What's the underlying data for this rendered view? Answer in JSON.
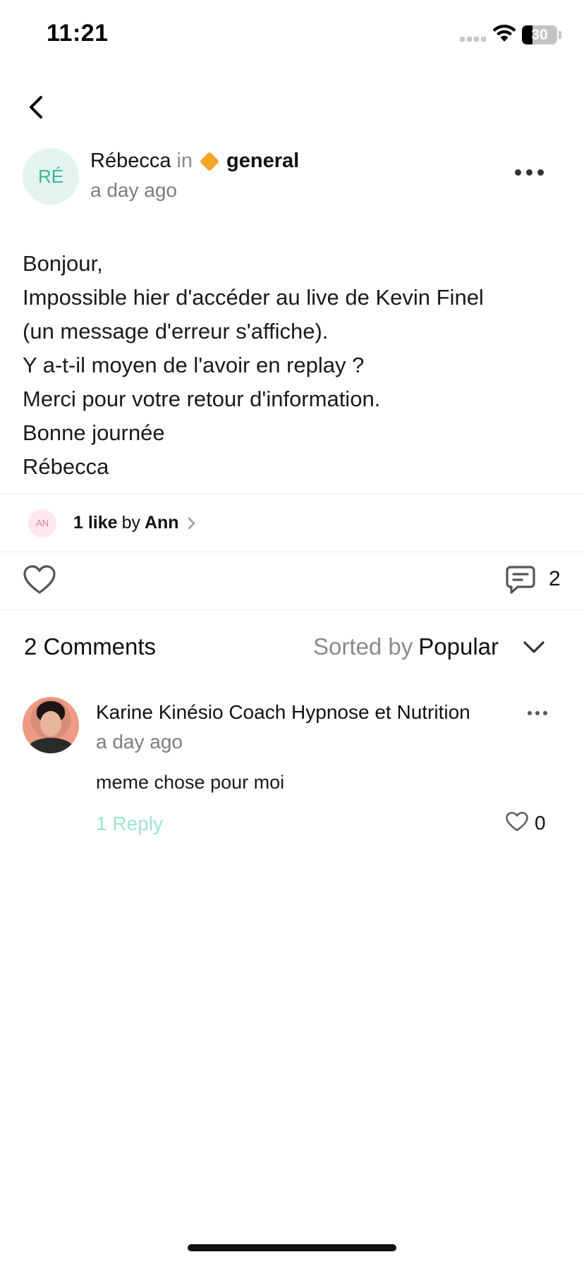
{
  "status_bar": {
    "time": "11:21",
    "battery": "30",
    "battery_level": 0.3
  },
  "post": {
    "author_initials": "RÉ",
    "author": "Rébecca",
    "in_label": "in",
    "space_icon": "orange-diamond",
    "space": "general",
    "time": "a day ago",
    "body_lines": [
      "Bonjour,",
      "Impossible hier d'accéder au live de Kevin Finel",
      "(un message d'erreur s'affiche).",
      "Y a-t-il moyen de l'avoir en replay ?",
      "Merci pour votre retour d'information.",
      "Bonne journée",
      "Rébecca"
    ],
    "likes": {
      "avatar_initials": "AN",
      "count_label": "1 like",
      "by_label": "by",
      "liker": "Ann"
    },
    "comment_count": "2"
  },
  "comments_section": {
    "title": "2 Comments",
    "sorted_label": "Sorted by",
    "sorted_value": "Popular",
    "comments": [
      {
        "author": "Karine Kinésio Coach Hypnose et Nutrition",
        "time": "a day ago",
        "body": "meme chose pour moi",
        "reply_label": "1 Reply",
        "likes": "0"
      }
    ]
  },
  "colors": {
    "accent": "#3ab59b",
    "reply": "#9ee3d2",
    "space_diamond": "#f5a623"
  }
}
